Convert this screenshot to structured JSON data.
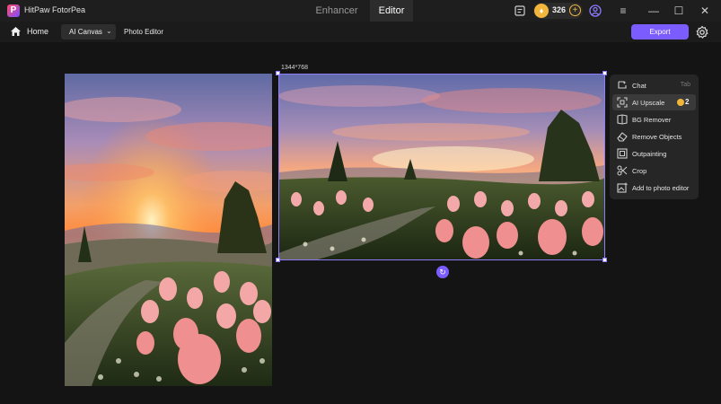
{
  "app": {
    "title": "HitPaw FotorPea",
    "logo_letter": "P",
    "mode_tabs": [
      {
        "label": "Enhancer",
        "active": false
      },
      {
        "label": "Editor",
        "active": true
      }
    ],
    "coins": "326",
    "accent_color": "#7b5cff",
    "coin_color": "#f2b73a"
  },
  "toolbar": {
    "home_label": "Home",
    "canvas_select_value": "AI Canvas",
    "photo_editor_label": "Photo Editor",
    "export_label": "Export"
  },
  "canvas": {
    "dimensions_label": "1344*768"
  },
  "context_menu": {
    "items": [
      {
        "label": "Chat",
        "shortcut": "Tab",
        "icon": "chat-icon"
      },
      {
        "label": "AI Upscale",
        "cost": "2",
        "icon": "upscale-icon",
        "active": true
      },
      {
        "label": "BG Remover",
        "icon": "bg-remover-icon"
      },
      {
        "label": "Remove Objects",
        "icon": "eraser-icon"
      },
      {
        "label": "Outpainting",
        "icon": "outpainting-icon"
      },
      {
        "label": "Crop",
        "icon": "scissors-icon"
      },
      {
        "label": "Add to photo editor",
        "icon": "add-image-icon"
      }
    ]
  }
}
